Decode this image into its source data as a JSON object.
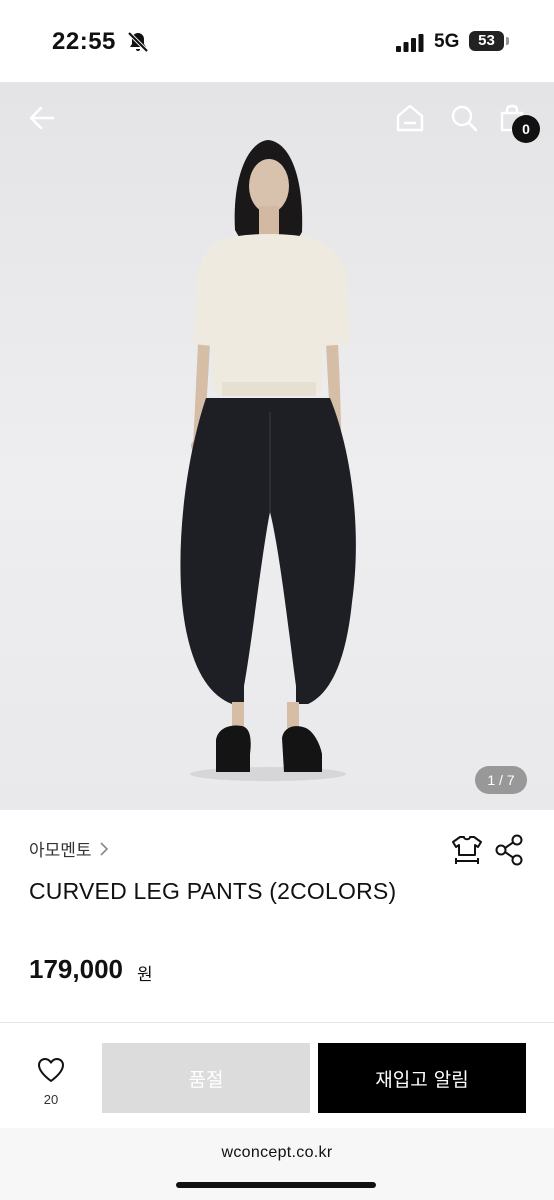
{
  "status_bar": {
    "time": "22:55",
    "network": "5G",
    "battery": "53"
  },
  "hero": {
    "image_description": "Model wearing cream short-sleeve knit top and black curved leg pants with black loafers on a light grey background",
    "pager": "1 / 7",
    "cart_count": "0"
  },
  "product": {
    "brand": "아모멘토",
    "name": "CURVED LEG PANTS (2COLORS)",
    "price": "179,000",
    "currency": "원"
  },
  "actions": {
    "wish_count": "20",
    "soldout_label": "품절",
    "restock_label": "재입고 알림"
  },
  "browser": {
    "url": "wconcept.co.kr"
  },
  "icons": [
    "bell-off-icon",
    "signal-icon",
    "battery-icon",
    "back-arrow-icon",
    "home-icon",
    "search-icon",
    "shopping-bag-icon",
    "chevron-right-icon",
    "size-guide-icon",
    "share-icon",
    "heart-icon"
  ],
  "colors": {
    "accent": "#000000",
    "soldout_bg": "#dcdcdc",
    "photo_bg": "#e9e9eb"
  }
}
